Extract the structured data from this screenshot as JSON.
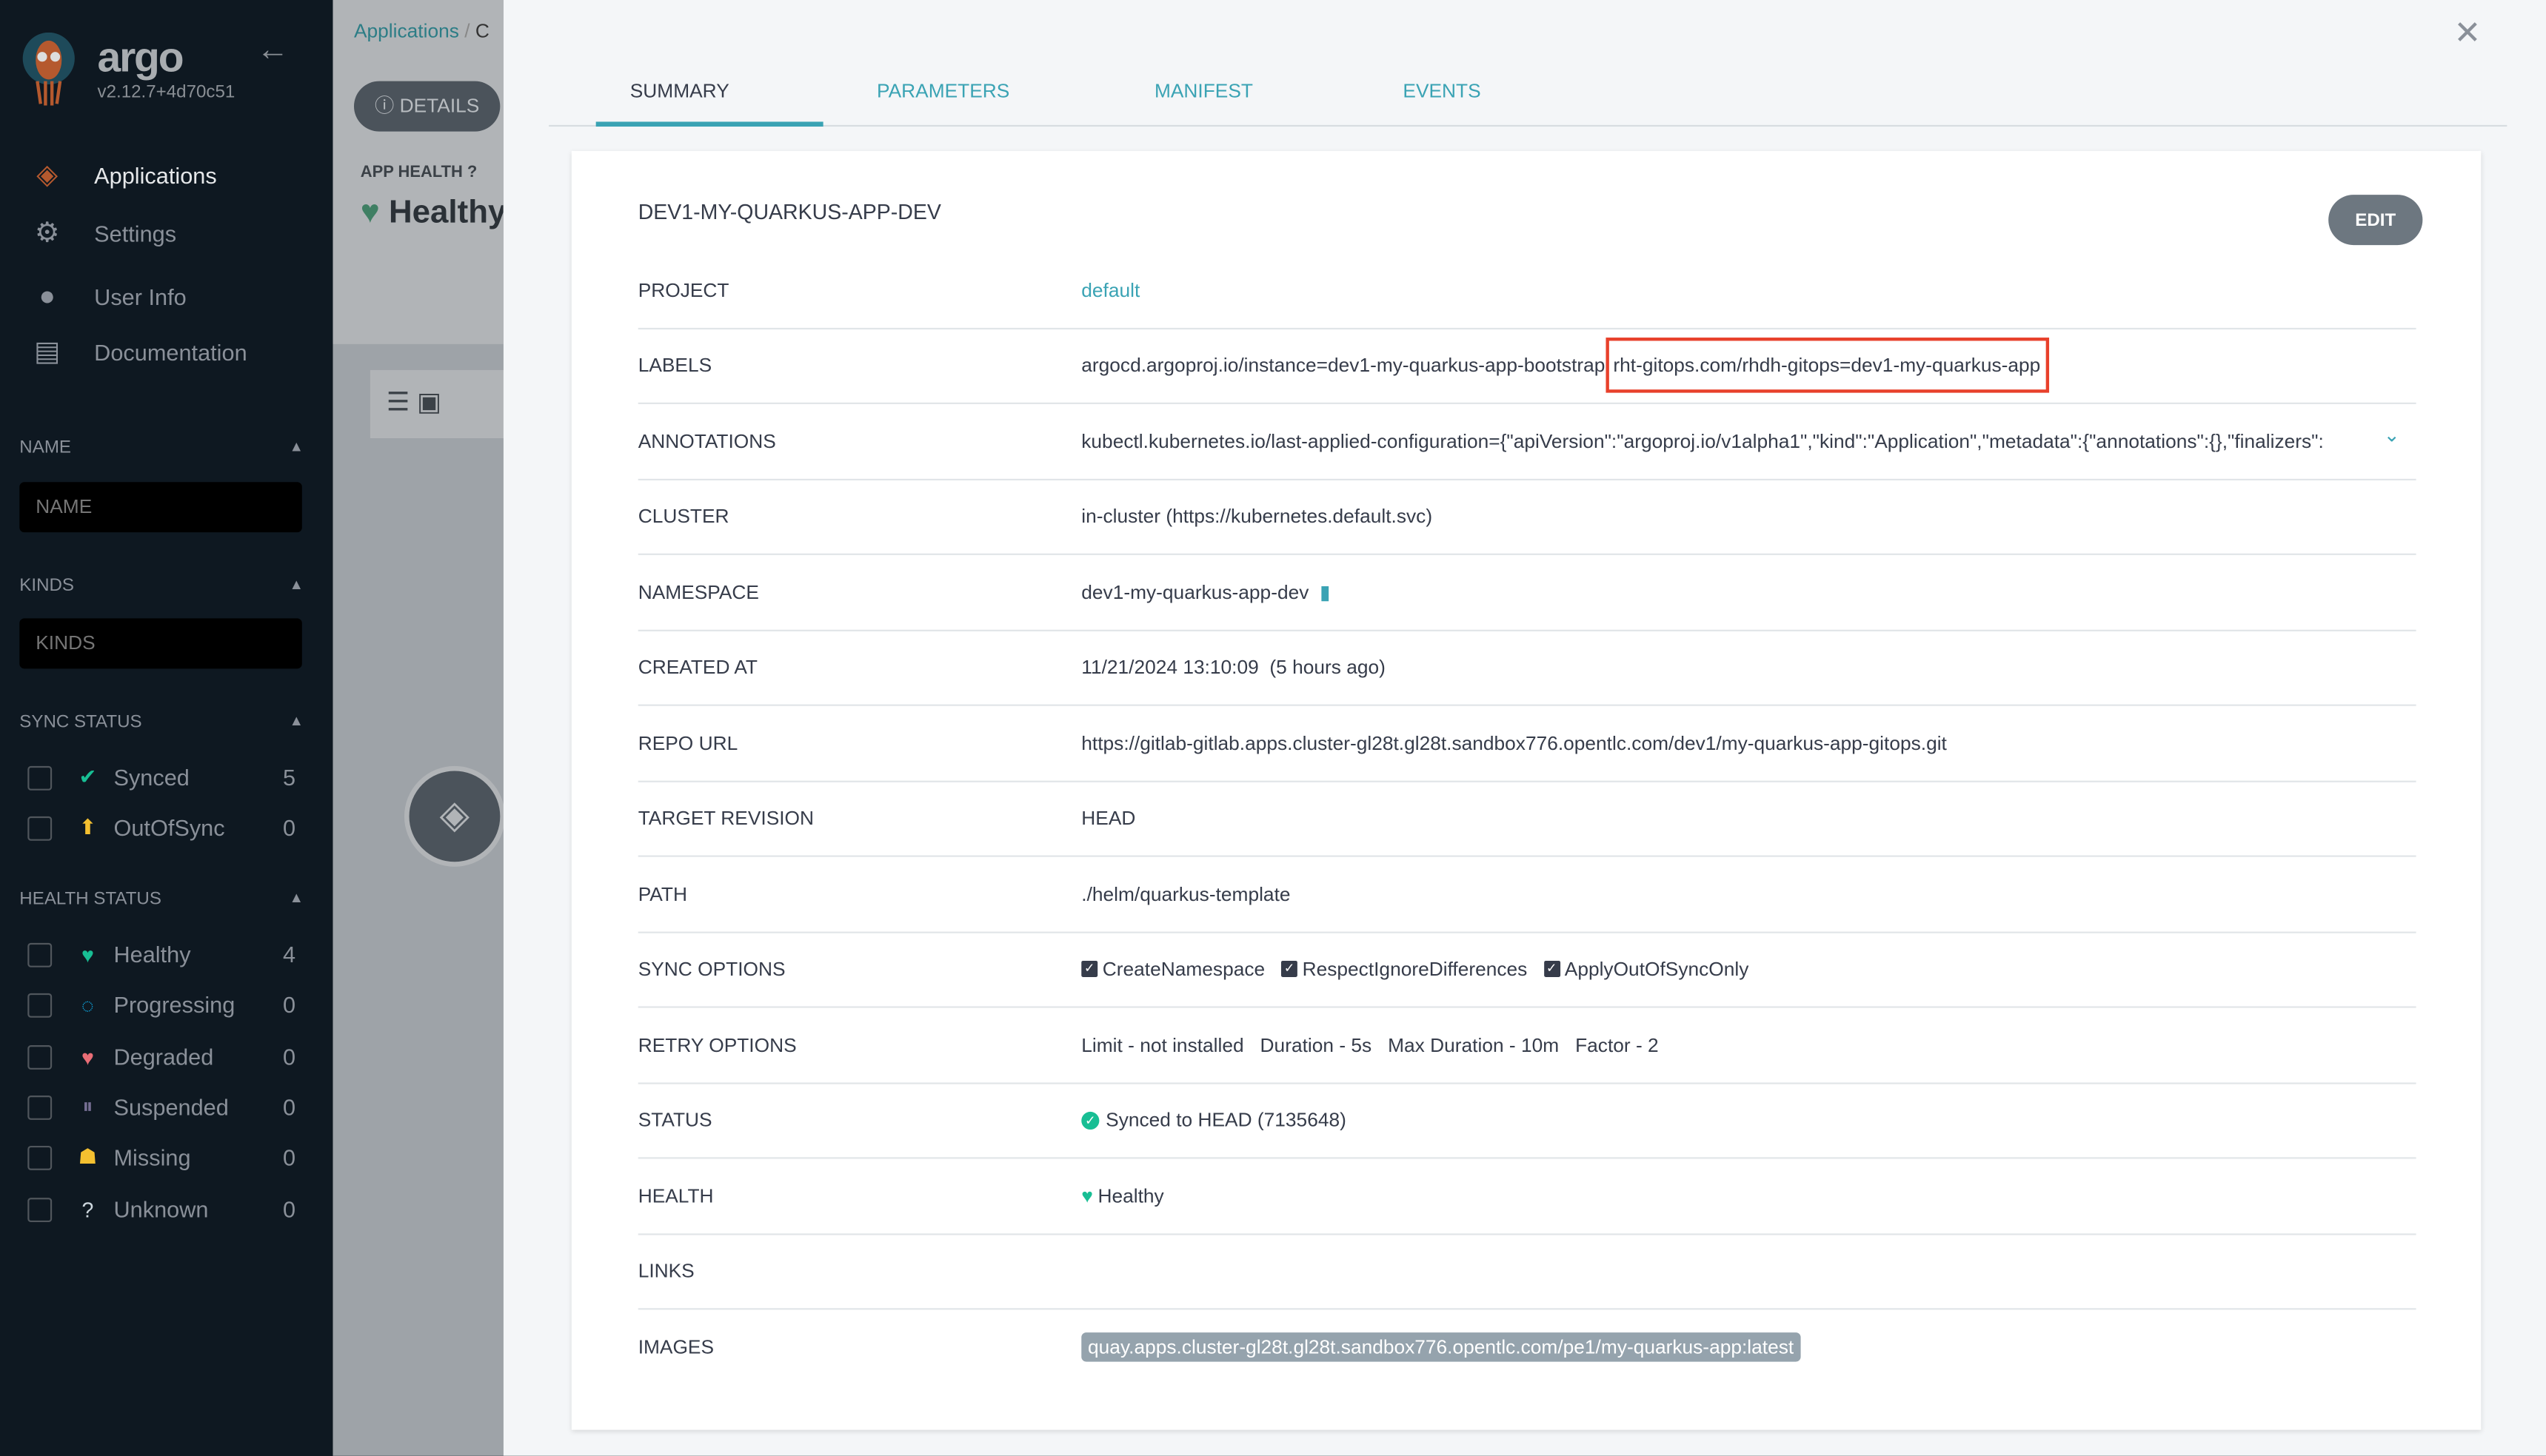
{
  "sidebar": {
    "brand": "argo",
    "version": "v2.12.7+4d70c51",
    "nav": [
      {
        "label": "Applications",
        "icon": "layers-icon"
      },
      {
        "label": "Settings",
        "icon": "gear-icon"
      },
      {
        "label": "User Info",
        "icon": "user-icon"
      },
      {
        "label": "Documentation",
        "icon": "book-icon"
      }
    ],
    "name_section": "NAME",
    "name_placeholder": "NAME",
    "kinds_section": "KINDS",
    "kinds_placeholder": "KINDS",
    "sync_section": "SYNC STATUS",
    "sync": [
      {
        "label": "Synced",
        "count": "5",
        "color": "#18be94"
      },
      {
        "label": "OutOfSync",
        "count": "0",
        "color": "#f4c030"
      }
    ],
    "health_section": "HEALTH STATUS",
    "health": [
      {
        "label": "Healthy",
        "count": "4",
        "color": "#18be94"
      },
      {
        "label": "Progressing",
        "count": "0",
        "color": "#0dadea"
      },
      {
        "label": "Degraded",
        "count": "0",
        "color": "#e96d76"
      },
      {
        "label": "Suspended",
        "count": "0",
        "color": "#766f94"
      },
      {
        "label": "Missing",
        "count": "0",
        "color": "#f4c030"
      },
      {
        "label": "Unknown",
        "count": "0",
        "color": "#ccd6dd"
      }
    ]
  },
  "middle": {
    "breadcrumb": "Applications",
    "breadcrumb_next": "C",
    "details": "DETAILS",
    "app_health": "APP HEALTH",
    "health_value": "Healthy"
  },
  "panel": {
    "tabs": [
      "SUMMARY",
      "PARAMETERS",
      "MANIFEST",
      "EVENTS"
    ],
    "title": "DEV1-MY-QUARKUS-APP-DEV",
    "edit": "EDIT",
    "rows": {
      "project": {
        "k": "PROJECT",
        "v": "default"
      },
      "labels": {
        "k": "LABELS",
        "v1": "argocd.argoproj.io/instance=dev1-my-quarkus-app-bootstrap",
        "v2": "rht-gitops.com/rhdh-gitops=dev1-my-quarkus-app"
      },
      "annotations": {
        "k": "ANNOTATIONS",
        "v": "kubectl.kubernetes.io/last-applied-configuration={\"apiVersion\":\"argoproj.io/v1alpha1\",\"kind\":\"Application\",\"metadata\":{\"annotations\":{},\"finalizers\":"
      },
      "cluster": {
        "k": "CLUSTER",
        "v": "in-cluster (https://kubernetes.default.svc)"
      },
      "namespace": {
        "k": "NAMESPACE",
        "v": "dev1-my-quarkus-app-dev"
      },
      "created": {
        "k": "CREATED AT",
        "v": "11/21/2024 13:10:09",
        "ago": "(5 hours ago)"
      },
      "repo": {
        "k": "REPO URL",
        "v": "https://gitlab-gitlab.apps.cluster-gl28t.gl28t.sandbox776.opentlc.com/dev1/my-quarkus-app-gitops.git"
      },
      "revision": {
        "k": "TARGET REVISION",
        "v": "HEAD"
      },
      "path": {
        "k": "PATH",
        "v": "./helm/quarkus-template"
      },
      "sync_options": {
        "k": "SYNC OPTIONS",
        "v": [
          "CreateNamespace",
          "RespectIgnoreDifferences",
          "ApplyOutOfSyncOnly"
        ]
      },
      "retry": {
        "k": "RETRY OPTIONS",
        "v": [
          "Limit - not installed",
          "Duration - 5s",
          "Max Duration - 10m",
          "Factor - 2"
        ]
      },
      "status": {
        "k": "STATUS",
        "v": "Synced to HEAD (7135648)"
      },
      "health": {
        "k": "HEALTH",
        "v": "Healthy"
      },
      "links": {
        "k": "LINKS"
      },
      "images": {
        "k": "IMAGES",
        "v": "quay.apps.cluster-gl28t.gl28t.sandbox776.opentlc.com/pe1/my-quarkus-app:latest"
      }
    }
  }
}
